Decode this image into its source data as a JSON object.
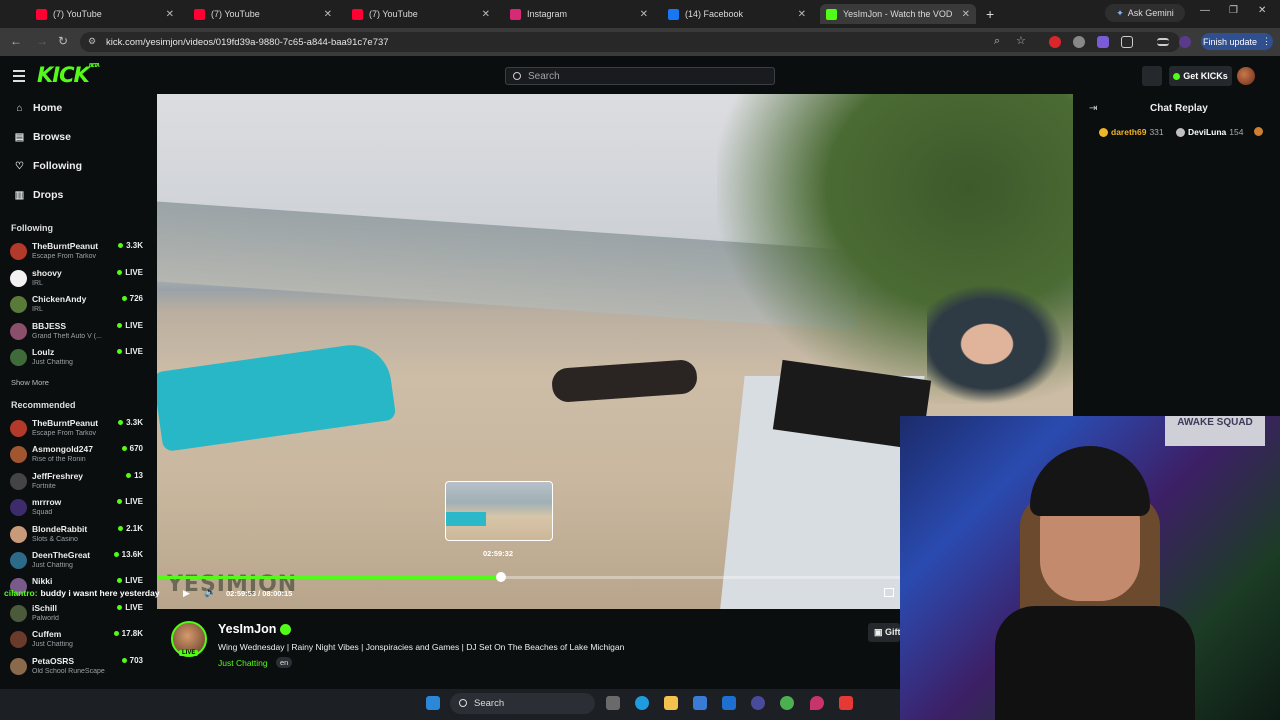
{
  "browser": {
    "tabs": [
      {
        "label": "(7) YouTube",
        "color": "#ff0033"
      },
      {
        "label": "(7) YouTube",
        "color": "#ff0033"
      },
      {
        "label": "(7) YouTube",
        "color": "#ff0033"
      },
      {
        "label": "Instagram",
        "color": "#d62976"
      },
      {
        "label": "(14) Facebook",
        "color": "#1877f2"
      },
      {
        "label": "YesImJon - Watch the VOD",
        "color": "#53fc18"
      }
    ],
    "new_tab": "+",
    "ask_gemini": "Ask Gemini",
    "url": "kick.com/yesimjon/videos/019fd39a-9880-7c65-a844-baa91c7e737",
    "finish_update": "Finish update"
  },
  "kick": {
    "logo": "KICK",
    "logo_sup": "BETA",
    "search_placeholder": "Search",
    "get_kicks": "Get KICKs"
  },
  "sidebar": {
    "nav": [
      {
        "label": "Home",
        "icon": "home-icon",
        "glyph": "⌂"
      },
      {
        "label": "Browse",
        "icon": "browse-icon",
        "glyph": "▤"
      },
      {
        "label": "Following",
        "icon": "heart-icon",
        "glyph": "♡"
      },
      {
        "label": "Drops",
        "icon": "drops-icon",
        "glyph": "▥"
      }
    ],
    "following_header": "Following",
    "following": [
      {
        "name": "TheBurntPeanut",
        "game": "Escape From Tarkov",
        "viewers": "3.3K",
        "avatar_color": "#b33a2a"
      },
      {
        "name": "shoovy",
        "game": "IRL",
        "viewers": "LIVE",
        "avatar_color": "#f2f2f2"
      },
      {
        "name": "ChickenAndy",
        "game": "IRL",
        "viewers": "726",
        "avatar_color": "#5a7a3a"
      },
      {
        "name": "BBJESS",
        "game": "Grand Theft Auto V (...",
        "viewers": "LIVE",
        "avatar_color": "#8a4f6a"
      },
      {
        "name": "Loulz",
        "game": "Just Chatting",
        "viewers": "LIVE",
        "avatar_color": "#3f6a3a"
      }
    ],
    "show_more": "Show More",
    "recommended_header": "Recommended",
    "recommended": [
      {
        "name": "TheBurntPeanut",
        "game": "Escape From Tarkov",
        "viewers": "3.3K",
        "avatar_color": "#b33a2a"
      },
      {
        "name": "Asmongold247",
        "game": "Rise of the Ronin",
        "viewers": "670",
        "avatar_color": "#a2562f"
      },
      {
        "name": "JeffFreshrey",
        "game": "Fortnite",
        "viewers": "13",
        "avatar_color": "#444"
      },
      {
        "name": "mrrrow",
        "game": "Squad",
        "viewers": "LIVE",
        "avatar_color": "#3c2c6b"
      },
      {
        "name": "BlondeRabbit",
        "game": "Slots & Casino",
        "viewers": "2.1K",
        "avatar_color": "#c99a7a"
      },
      {
        "name": "DeenTheGreat",
        "game": "Just Chatting",
        "viewers": "13.6K",
        "avatar_color": "#2c6a8a"
      },
      {
        "name": "Nikki",
        "game": "",
        "viewers": "LIVE",
        "avatar_color": "#7a5a8a"
      },
      {
        "name": "iSchill",
        "game": "Palworld",
        "viewers": "LIVE",
        "avatar_color": "#4a5a3a"
      },
      {
        "name": "Cuffem",
        "game": "Just Chatting",
        "viewers": "17.8K",
        "avatar_color": "#6a3a2a"
      },
      {
        "name": "PetaOSRS",
        "game": "Old School RuneScape",
        "viewers": "703",
        "avatar_color": "#8a6a4a"
      }
    ]
  },
  "player": {
    "watermark": "YESIMJON",
    "preview_time": "02:59:32",
    "current_time": "02:59:53",
    "duration": "08:00:15",
    "progress_fraction": 0.375,
    "chat_overlay_user": "cilantro:",
    "chat_overlay_text": "buddy i wasnt here yesterday"
  },
  "chat": {
    "title": "Chat Replay",
    "gifters": [
      {
        "name": "dareth69",
        "count": "331",
        "color": "#f0b429"
      },
      {
        "name": "DeviLuna",
        "count": "154",
        "color": "#c0c0c0"
      }
    ]
  },
  "webcam": {
    "poster_text": "AWAKE SQUAD"
  },
  "stream": {
    "channel": "YesImJon",
    "live_badge": "LIVE",
    "title": "Wing Wednesday | Rainy Night Vibes | Jonspiracies and Games | DJ Set On The Beaches of Lake Michigan",
    "category": "Just Chatting",
    "language": "en",
    "gift_label": "Gift"
  },
  "taskbar": {
    "search_placeholder": "Search"
  }
}
